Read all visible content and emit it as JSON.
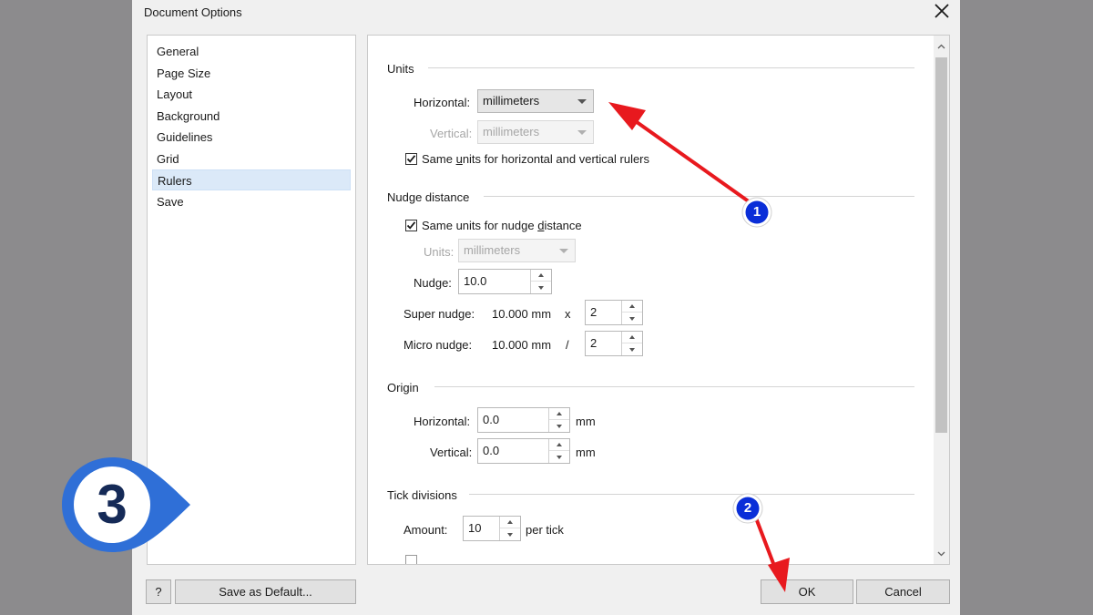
{
  "dialog": {
    "title": "Document Options",
    "close_glyph": "✕"
  },
  "nav": {
    "items": [
      {
        "label": "General"
      },
      {
        "label": "Page Size"
      },
      {
        "label": "Layout"
      },
      {
        "label": "Background"
      },
      {
        "label": "Guidelines"
      },
      {
        "label": "Grid"
      },
      {
        "label": "Rulers",
        "selected": true
      },
      {
        "label": "Save"
      }
    ]
  },
  "units": {
    "section": "Units",
    "horizontal_label": "Horizontal:",
    "horizontal_value": "millimeters",
    "vertical_label": "Vertical:",
    "vertical_value": "millimeters",
    "same_units_pre": "Same ",
    "same_units_key": "u",
    "same_units_post": "nits for horizontal and vertical rulers",
    "same_units_checked": true
  },
  "nudge": {
    "section": "Nudge distance",
    "same_pre": "Same units for nudge ",
    "same_key": "d",
    "same_post": "istance",
    "same_checked": true,
    "units_label": "Units:",
    "units_value": "millimeters",
    "nudge_label": "Nudge:",
    "nudge_value": "10.0",
    "super_label": "Super nudge:",
    "super_amount": "10.000 mm",
    "super_op": "x",
    "super_value": "2",
    "micro_label": "Micro nudge:",
    "micro_amount": "10.000 mm",
    "micro_op": "/",
    "micro_value": "2"
  },
  "origin": {
    "section": "Origin",
    "horizontal_label": "Horizontal:",
    "horizontal_value": "0.0",
    "horizontal_unit": "mm",
    "vertical_label": "Vertical:",
    "vertical_value": "0.0",
    "vertical_unit": "mm"
  },
  "ticks": {
    "section": "Tick divisions",
    "amount_label": "Amount:",
    "amount_value": "10",
    "amount_unit": "per tick"
  },
  "footer": {
    "help_label": "?",
    "save_default_label": "Save as Default...",
    "ok_label": "OK",
    "cancel_label": "Cancel"
  },
  "annotations": {
    "step1": "1",
    "step2": "2",
    "step3": "3",
    "arrow_color": "#e8191e",
    "badge_color": "#0a2ed8",
    "badge3_color": "#2f6fd7"
  }
}
